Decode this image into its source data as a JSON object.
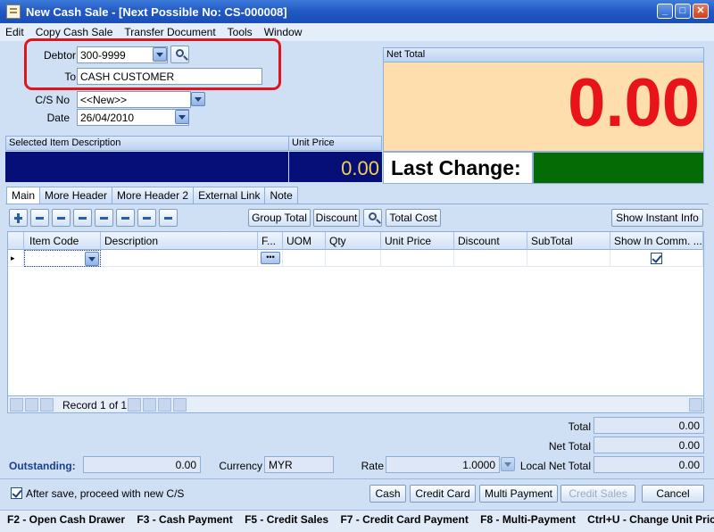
{
  "window": {
    "title": "New Cash Sale - [Next Possible No: CS-000008]"
  },
  "menu": [
    "Edit",
    "Copy Cash Sale",
    "Transfer Document",
    "Tools",
    "Window"
  ],
  "header": {
    "debtor_label": "Debtor",
    "debtor_value": "300-9999",
    "to_label": "To",
    "to_value": "CASH CUSTOMER",
    "csno_label": "C/S No",
    "csno_value": "<<New>>",
    "date_label": "Date",
    "date_value": "26/04/2010"
  },
  "net_total": {
    "label": "Net Total",
    "value": "0.00"
  },
  "item_panel": {
    "desc_label": "Selected Item Description",
    "unit_price_label": "Unit Price",
    "unit_price_value": "0.00"
  },
  "last_change": {
    "label": "Last Change:"
  },
  "tabs": [
    "Main",
    "More Header",
    "More Header 2",
    "External Link",
    "Note"
  ],
  "toolbar": {
    "group_total": "Group Total",
    "discount": "Discount",
    "total_cost": "Total Cost",
    "show_instant_info": "Show Instant Info"
  },
  "grid": {
    "columns": [
      "Item Code",
      "Description",
      "F...",
      "UOM",
      "Qty",
      "Unit Price",
      "Discount",
      "SubTotal",
      "Show In Comm. ..."
    ],
    "record_text": "Record 1 of 1"
  },
  "summary": {
    "total_label": "Total",
    "total_value": "0.00",
    "net_total_label": "Net Total",
    "net_total_value": "0.00",
    "local_net_total_label": "Local Net Total",
    "local_net_total_value": "0.00",
    "outstanding_label": "Outstanding:",
    "outstanding_value": "0.00",
    "currency_label": "Currency",
    "currency_value": "MYR",
    "rate_label": "Rate",
    "rate_value": "1.0000"
  },
  "footer": {
    "after_save_label": "After save, proceed with new C/S",
    "cash": "Cash",
    "credit_card": "Credit Card",
    "multi_payment": "Multi Payment",
    "credit_sales": "Credit Sales",
    "cancel": "Cancel"
  },
  "statusbar": {
    "text": "F2 - Open Cash Drawer    F3 - Cash Payment    F5 - Credit Sales    F7 - Credit Card Payment    F8 - Multi-Payment    Ctrl+U - Change Unit Pric"
  },
  "colors": {
    "net_total_bg": "#fddeac",
    "net_total_text": "#e8141a",
    "unit_price_bg": "#060f78",
    "unit_price_text": "#f1d34a",
    "last_change_box": "#056b05",
    "highlight": "#e0151b"
  }
}
